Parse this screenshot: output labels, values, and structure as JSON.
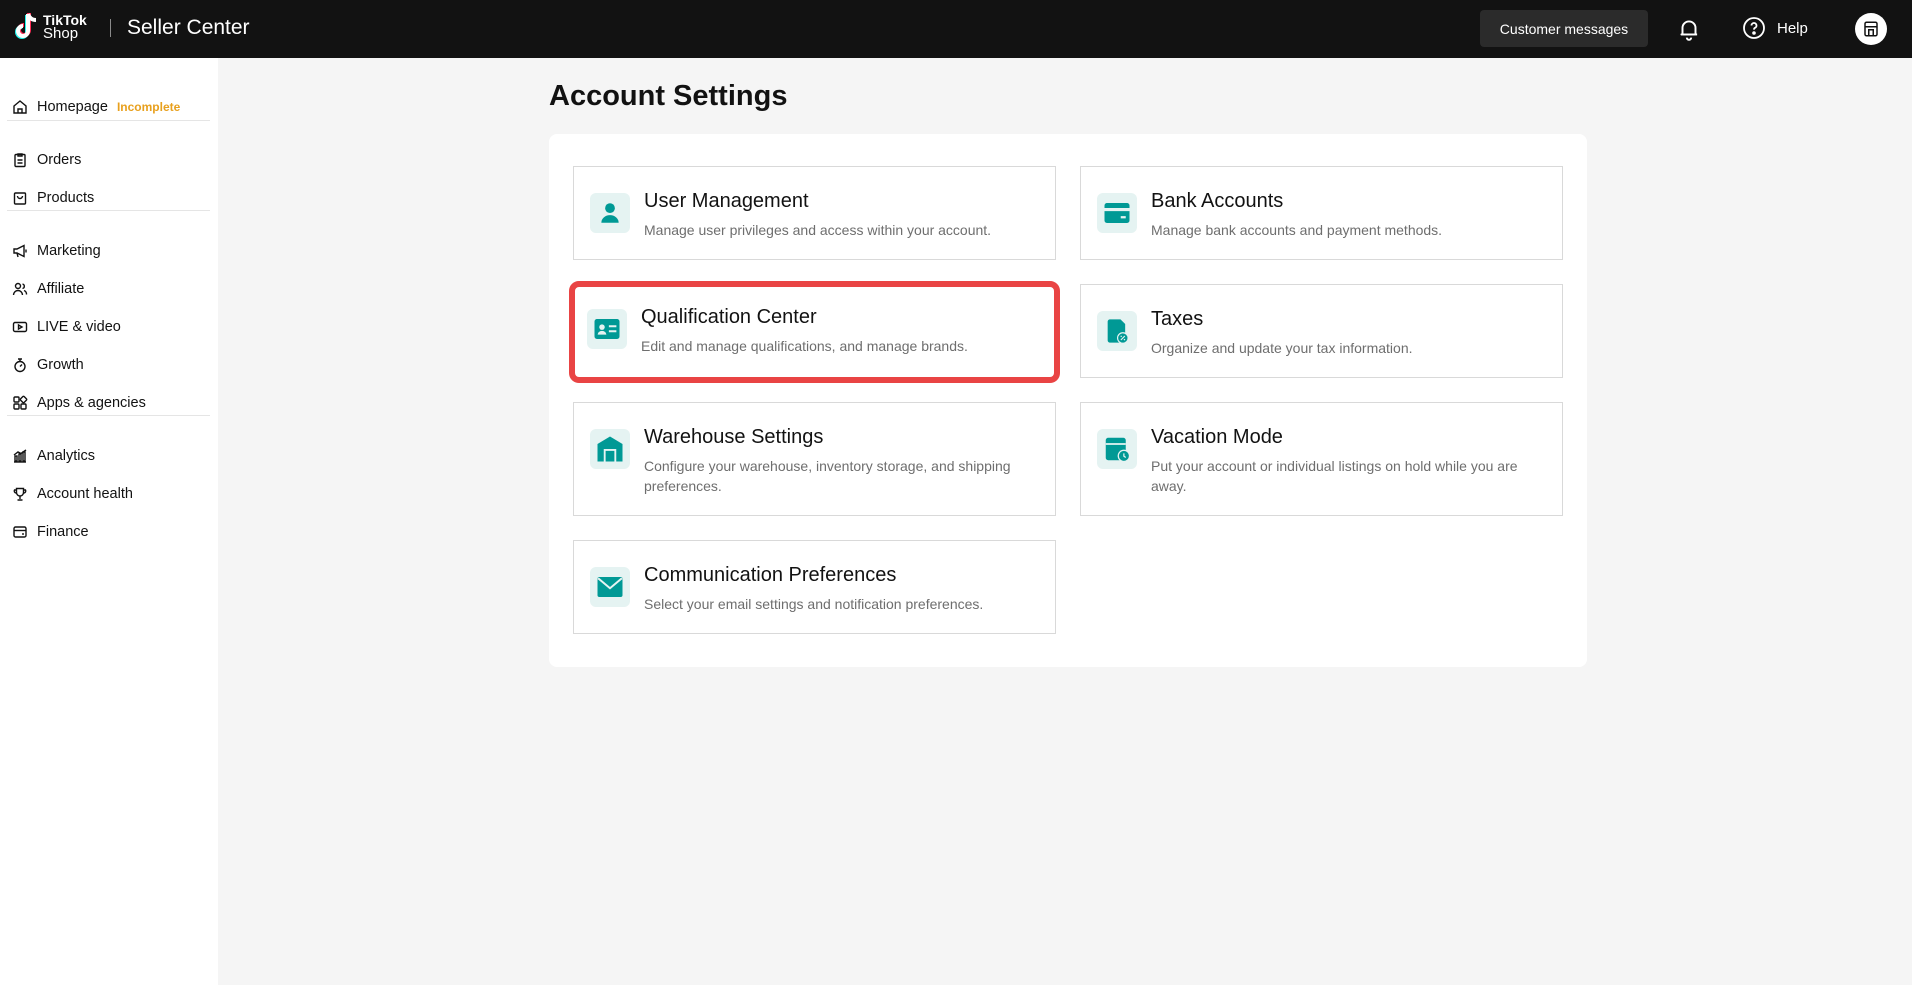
{
  "topbar": {
    "logo_line1": "TikTok",
    "logo_line2": "Shop",
    "app_title": "Seller Center",
    "customer_messages": "Customer messages",
    "help": "Help"
  },
  "sidebar": {
    "items": [
      {
        "label": "Homepage",
        "icon": "home-icon",
        "badge": "Incomplete"
      },
      {
        "label": "Orders",
        "icon": "clipboard-icon"
      },
      {
        "label": "Products",
        "icon": "bag-icon"
      },
      {
        "label": "Marketing",
        "icon": "megaphone-icon"
      },
      {
        "label": "Affiliate",
        "icon": "users-icon"
      },
      {
        "label": "LIVE & video",
        "icon": "video-icon"
      },
      {
        "label": "Growth",
        "icon": "growth-icon"
      },
      {
        "label": "Apps & agencies",
        "icon": "apps-icon"
      },
      {
        "label": "Analytics",
        "icon": "chart-icon"
      },
      {
        "label": "Account health",
        "icon": "trophy-icon"
      },
      {
        "label": "Finance",
        "icon": "wallet-icon"
      }
    ]
  },
  "main": {
    "title": "Account Settings",
    "cards": [
      {
        "title": "User Management",
        "desc": "Manage user privileges and access within your account.",
        "icon": "user-icon"
      },
      {
        "title": "Bank Accounts",
        "desc": "Manage bank accounts and payment methods.",
        "icon": "bank-card-icon"
      },
      {
        "title": "Qualification Center",
        "desc": "Edit and manage qualifications, and manage brands.",
        "icon": "id-card-icon"
      },
      {
        "title": "Taxes",
        "desc": "Organize and update your tax information.",
        "icon": "tax-document-icon"
      },
      {
        "title": "Warehouse Settings",
        "desc": "Configure your warehouse, inventory storage, and shipping preferences.",
        "icon": "warehouse-icon"
      },
      {
        "title": "Vacation Mode",
        "desc": "Put your account or individual listings on hold while you are away.",
        "icon": "vacation-store-icon"
      },
      {
        "title": "Communication Preferences",
        "desc": "Select your email settings and notification preferences.",
        "icon": "envelope-icon"
      }
    ]
  },
  "colors": {
    "topbar_bg": "#121212",
    "accent_teal": "#009995",
    "highlight_red": "#e94444",
    "badge_orange": "#e8a01d"
  }
}
